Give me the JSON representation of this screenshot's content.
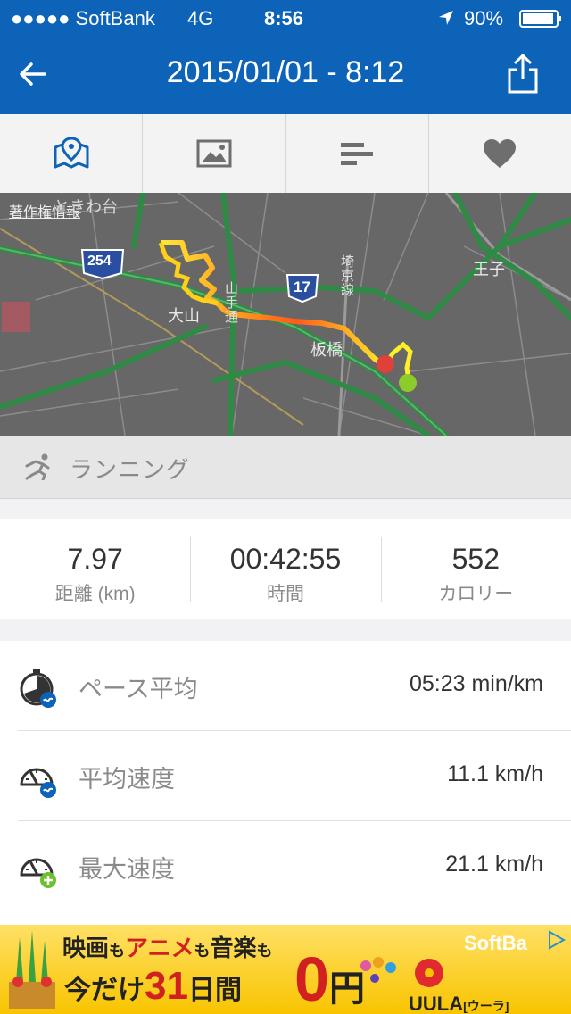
{
  "status_bar": {
    "carrier": "●●●●● SoftBank",
    "network": "4G",
    "time": "8:56",
    "battery": "90%"
  },
  "nav": {
    "title": "2015/01/01 - 8:12",
    "back_icon": "back-arrow-icon",
    "share_icon": "share-icon"
  },
  "tabs": [
    {
      "name": "map",
      "icon": "map-pin-icon",
      "active": true
    },
    {
      "name": "photos",
      "icon": "image-icon",
      "active": false
    },
    {
      "name": "charts",
      "icon": "bar-list-icon",
      "active": false
    },
    {
      "name": "favorite",
      "icon": "heart-icon",
      "active": false
    }
  ],
  "map": {
    "attribution": "著作権情報",
    "labels": {
      "area_top": "ときわ台",
      "oyama": "大山",
      "itabashi": "板橋",
      "oji": "王子",
      "yamanote": "山手通",
      "saikyo": "埼京線"
    },
    "shields": {
      "route_254": "254",
      "route_17": "17"
    }
  },
  "activity": {
    "icon": "running-icon",
    "label": "ランニング"
  },
  "summary": [
    {
      "value": "7.97",
      "label": "距離 (km)"
    },
    {
      "value": "00:42:55",
      "label": "時間"
    },
    {
      "value": "552",
      "label": "カロリー"
    }
  ],
  "details": [
    {
      "icon": "pace-stopwatch-icon",
      "label": "ペース平均",
      "value": "05:23 min/km"
    },
    {
      "icon": "avg-speed-icon",
      "label": "平均速度",
      "value": "11.1 km/h"
    },
    {
      "icon": "max-speed-icon",
      "label": "最大速度",
      "value": "21.1 km/h"
    }
  ],
  "ad": {
    "line1a": "映画",
    "line1b": "も",
    "line1c": "アニメ",
    "line1d": "も",
    "line1e": "音楽",
    "line1f": "も",
    "line2a": "今だけ",
    "line2b": "31",
    "line2c": "日間",
    "line2d": "0",
    "line2e": "円",
    "brand": "UULA",
    "brand_kana": "[ウーラ]",
    "sponsor": "SoftBa"
  },
  "colors": {
    "primary": "#0c63b8",
    "map_bg": "#676767",
    "route_start": "#8ccc2a",
    "route_end": "#e0403a"
  }
}
